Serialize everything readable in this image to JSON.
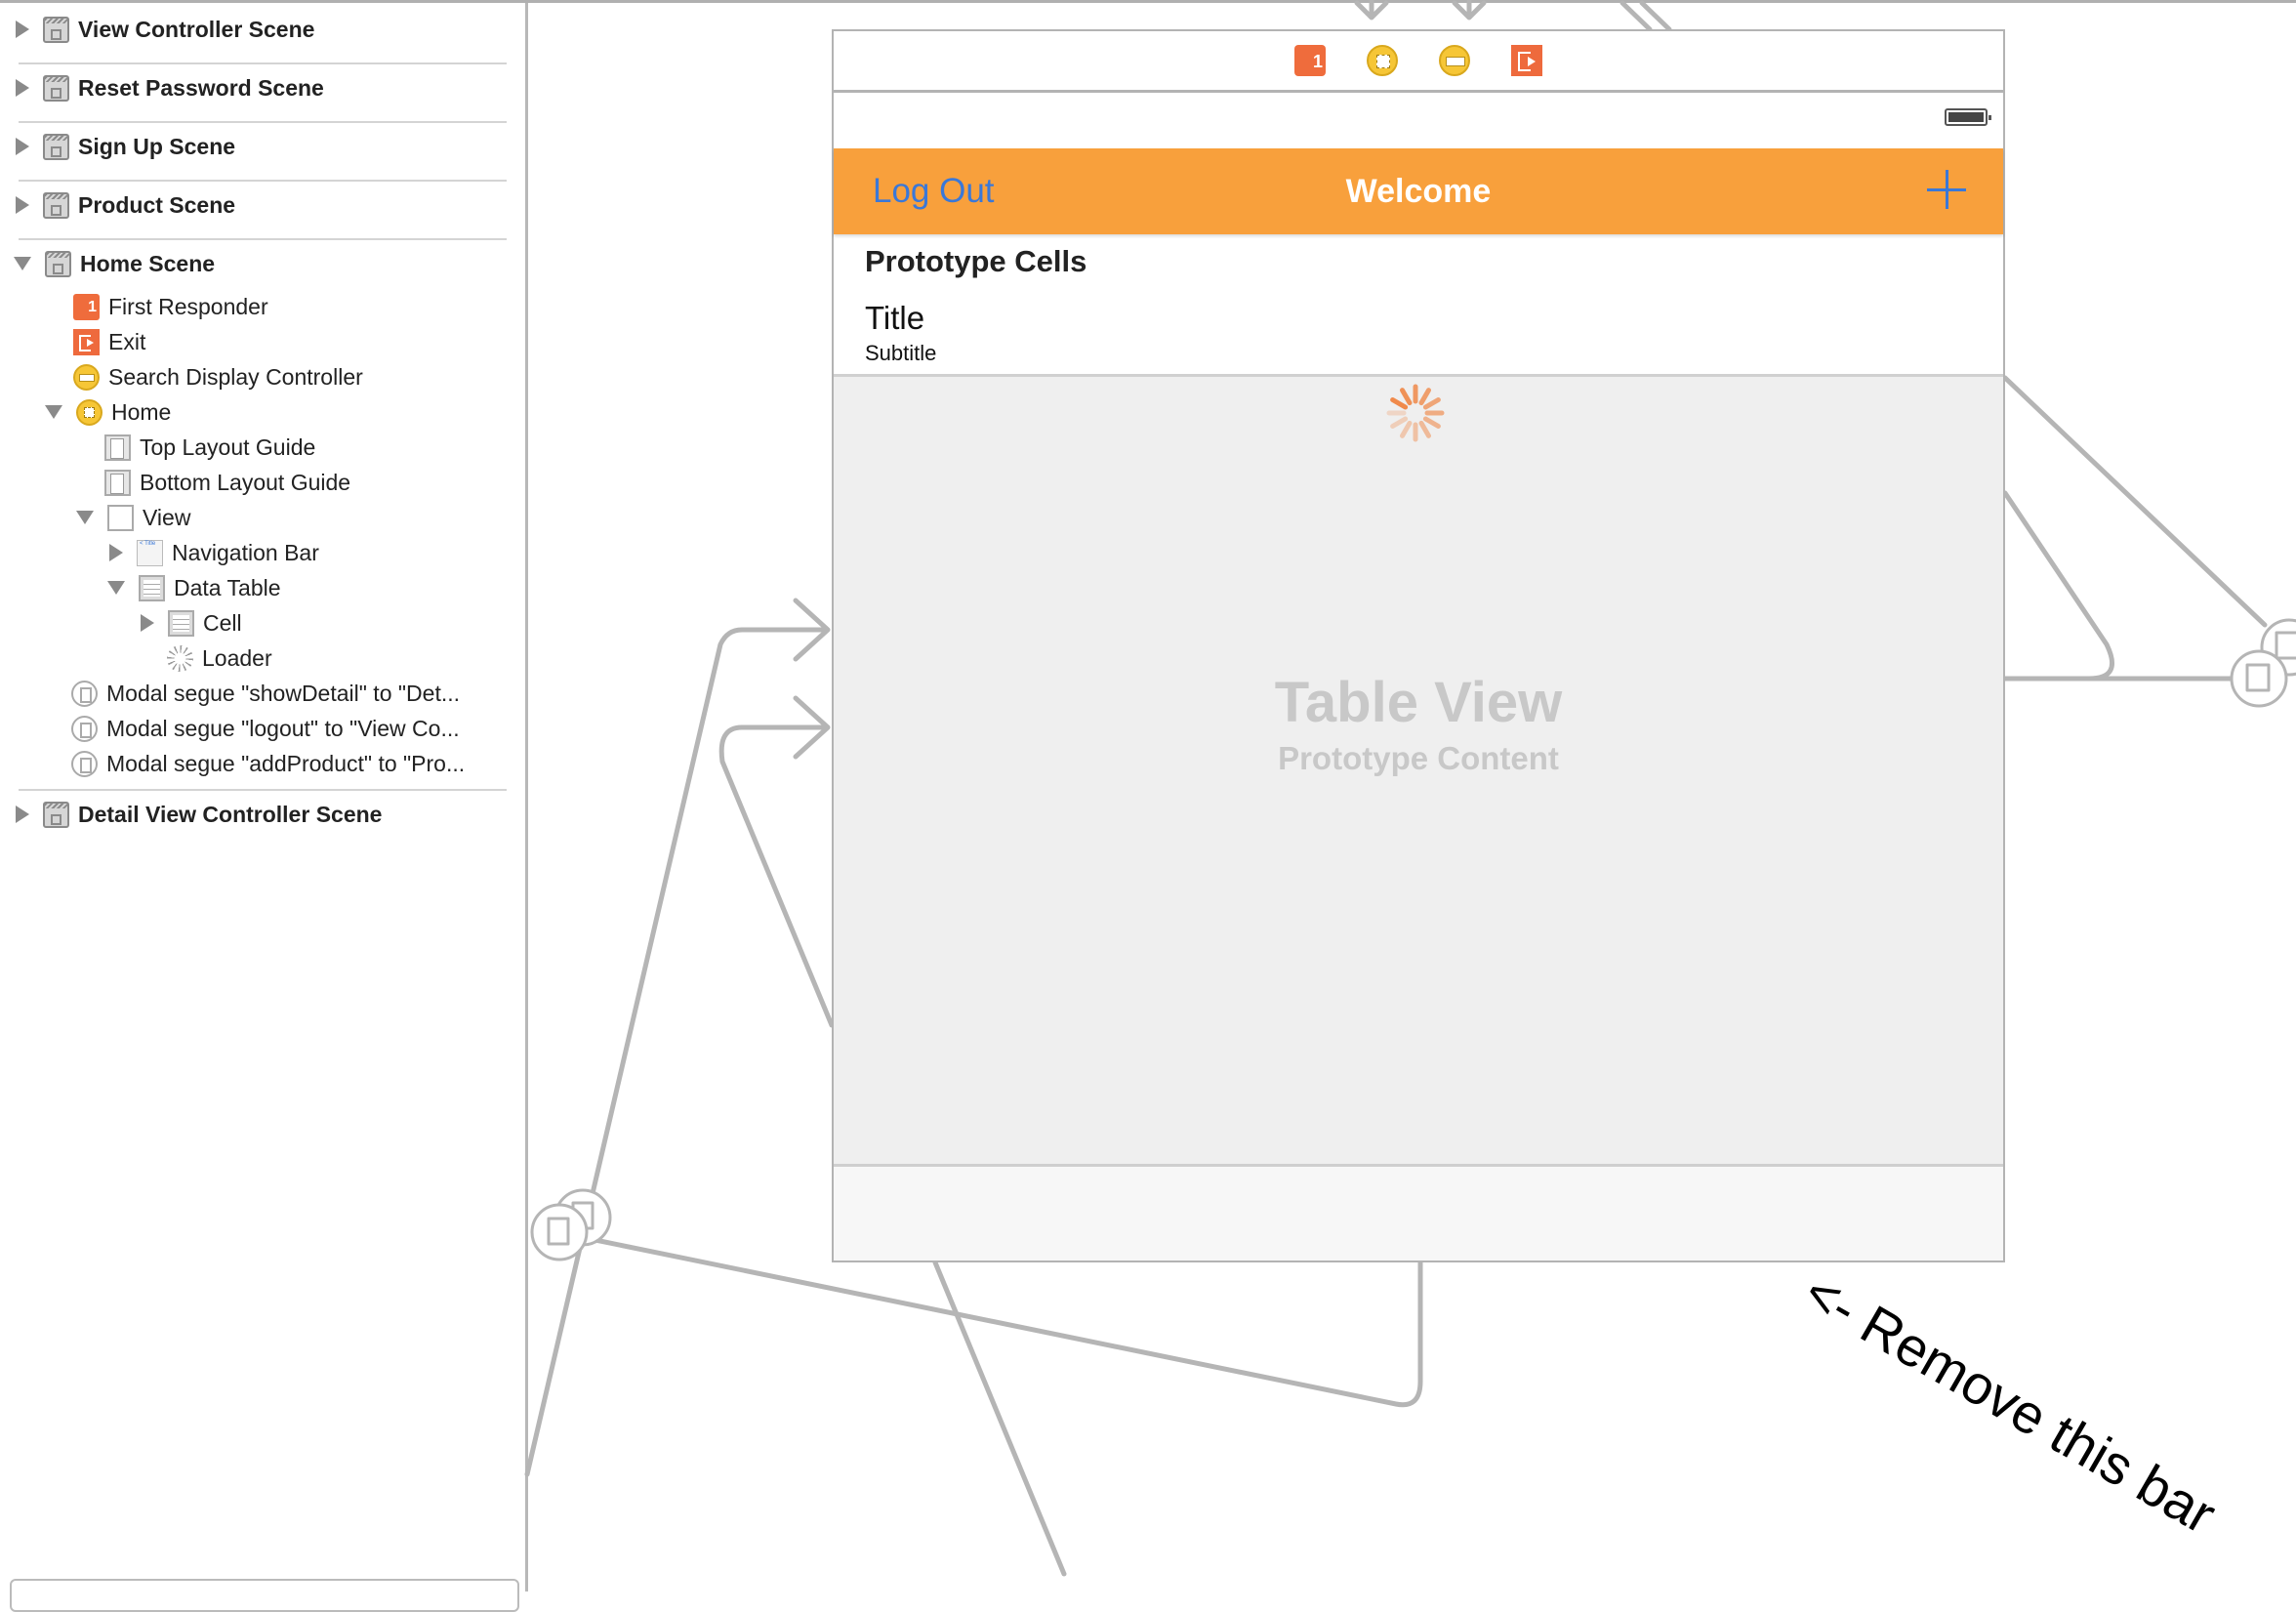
{
  "outline": {
    "items": [
      {
        "label": "View Controller Scene",
        "type": "scene",
        "expanded": false,
        "icon": "scene-icon"
      },
      {
        "label": "Reset Password Scene",
        "type": "scene",
        "expanded": false,
        "icon": "scene-icon"
      },
      {
        "label": "Sign Up Scene",
        "type": "scene",
        "expanded": false,
        "icon": "scene-icon"
      },
      {
        "label": "Product Scene",
        "type": "scene",
        "expanded": false,
        "icon": "scene-icon"
      },
      {
        "label": "Home Scene",
        "type": "scene",
        "expanded": true,
        "icon": "scene-icon"
      },
      {
        "label": "First Responder",
        "icon": "first-responder-icon"
      },
      {
        "label": "Exit",
        "icon": "exit-icon"
      },
      {
        "label": "Search Display Controller",
        "icon": "search-display-controller-icon"
      },
      {
        "label": "Home",
        "expanded": true,
        "icon": "view-controller-icon"
      },
      {
        "label": "Top Layout Guide",
        "icon": "layout-guide-icon"
      },
      {
        "label": "Bottom Layout Guide",
        "icon": "layout-guide-icon"
      },
      {
        "label": "View",
        "expanded": true,
        "icon": "view-icon"
      },
      {
        "label": "Navigation Bar",
        "expanded": false,
        "icon": "navigation-bar-icon"
      },
      {
        "label": "Data Table",
        "expanded": true,
        "icon": "table-view-icon"
      },
      {
        "label": "Cell",
        "expanded": false,
        "icon": "table-cell-icon"
      },
      {
        "label": "Loader",
        "icon": "activity-indicator-icon"
      },
      {
        "label": "Modal segue \"showDetail\" to \"Det...",
        "icon": "segue-icon"
      },
      {
        "label": "Modal segue \"logout\" to \"View Co...",
        "icon": "segue-icon"
      },
      {
        "label": "Modal segue \"addProduct\" to \"Pro...",
        "icon": "segue-icon"
      },
      {
        "label": "Detail View Controller Scene",
        "type": "scene",
        "expanded": false,
        "icon": "scene-icon"
      }
    ]
  },
  "scene": {
    "dock_icons": [
      "first-responder-icon",
      "view-controller-icon",
      "search-display-controller-icon",
      "exit-icon"
    ],
    "navbar": {
      "left_button": "Log Out",
      "title": "Welcome",
      "right_button_icon": "plus-icon",
      "bar_color": "#f8a03c",
      "tint_color": "#3a78d8"
    },
    "table": {
      "section_header": "Prototype Cells",
      "cell_title": "Title",
      "cell_subtitle": "Subtitle",
      "placeholder_title": "Table View",
      "placeholder_subtitle": "Prototype Content"
    },
    "annotation": "<- Remove this bar"
  }
}
